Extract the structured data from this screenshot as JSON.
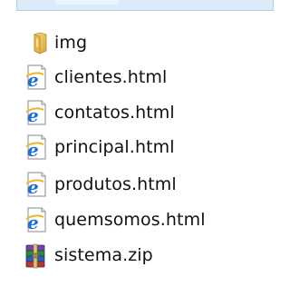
{
  "files": [
    {
      "name": "img",
      "icon": "folder-icon"
    },
    {
      "name": "clientes.html",
      "icon": "html-file-icon"
    },
    {
      "name": "contatos.html",
      "icon": "html-file-icon"
    },
    {
      "name": "principal.html",
      "icon": "html-file-icon"
    },
    {
      "name": "produtos.html",
      "icon": "html-file-icon"
    },
    {
      "name": "quemsomos.html",
      "icon": "html-file-icon"
    },
    {
      "name": "sistema.zip",
      "icon": "zip-archive-icon"
    }
  ],
  "colors": {
    "text": "#111111",
    "folder": "#e8b84a",
    "ie_blue": "#1f6fd1",
    "header_strip": "#dcebf9"
  }
}
